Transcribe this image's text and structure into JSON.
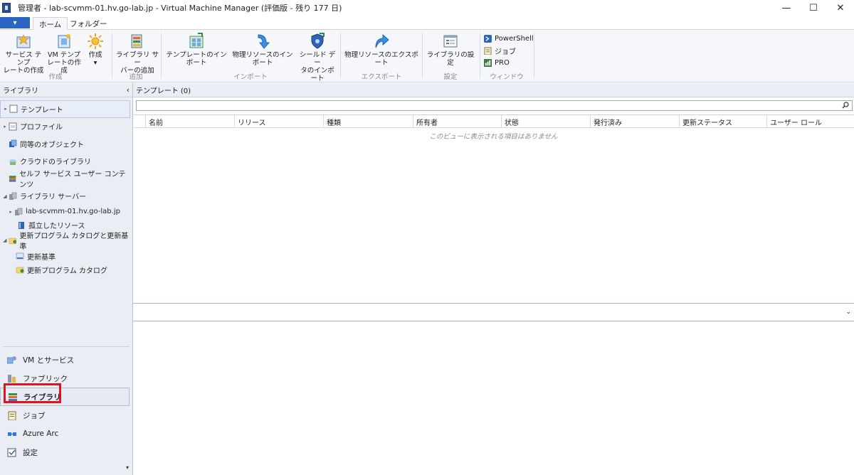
{
  "window": {
    "title": "管理者 - lab-scvmm-01.hv.go-lab.jp - Virtual Machine Manager (評価版 - 残り 177 日)",
    "minimize": "—",
    "maximize": "☐",
    "close": "✕"
  },
  "ribbon": {
    "file_menu": "▾",
    "tabs": [
      {
        "label": "ホーム"
      },
      {
        "label": "フォルダー"
      }
    ],
    "buttons": {
      "create_service_template": "サービス テンプ\nレートの作成",
      "create_vm_template": "VM テンプ\nレートの作成",
      "create": "作成",
      "create_dropdown": "▾",
      "add_library_server": "ライブラリ サー\nバーの追加",
      "import_template": "テンプレートのインポート",
      "import_physical_resource": "物理リソースのインポート",
      "import_shielding_data": "シールド デー\nタのインポート",
      "export_physical_resource": "物理リソースのエクスポート",
      "library_settings": "ライブラリの設定"
    },
    "groups": {
      "create": "作成",
      "add": "追加",
      "import": "インポート",
      "export": "エクスポート",
      "settings": "設定",
      "window": "ウィンドウ"
    },
    "window_items": [
      "PowerShell",
      "ジョブ",
      "PRO"
    ]
  },
  "left_pane": {
    "header": "ライブラリ",
    "collapse_glyph": "‹",
    "tree": [
      {
        "label": "テンプレート",
        "arrow": "▸"
      },
      {
        "label": "プロファイル",
        "arrow": "▸"
      },
      {
        "label": "同等のオブジェクト",
        "arrow": ""
      },
      {
        "label": "クラウドのライブラリ",
        "arrow": ""
      },
      {
        "label": "セルフ サービス ユーザー コンテンツ",
        "arrow": ""
      },
      {
        "label": "ライブラリ サーバー",
        "arrow": "◢"
      },
      {
        "label": "lab-scvmm-01.hv.go-lab.jp",
        "arrow": "▸"
      },
      {
        "label": "孤立したリソース",
        "arrow": ""
      },
      {
        "label": "更新プログラム カタログと更新基準",
        "arrow": "◢"
      },
      {
        "label": "更新基準",
        "arrow": ""
      },
      {
        "label": "更新プログラム カタログ",
        "arrow": ""
      }
    ],
    "workspaces": [
      {
        "label": "VM とサービス"
      },
      {
        "label": "ファブリック"
      },
      {
        "label": "ライブラリ"
      },
      {
        "label": "ジョブ"
      },
      {
        "label": "Azure Arc"
      },
      {
        "label": "設定"
      }
    ],
    "scroll_glyph": "▾"
  },
  "content": {
    "title": "テンプレート (0)",
    "collapse_glyph": "‹",
    "search": {
      "value": "",
      "placeholder": ""
    },
    "columns": [
      "名前",
      "リリース",
      "種類",
      "所有者",
      "状態",
      "発行済み",
      "更新ステータス",
      "ユーザー ロール"
    ],
    "empty_message": "このビューに表示される項目はありません",
    "detail_chevron": "⌄"
  }
}
